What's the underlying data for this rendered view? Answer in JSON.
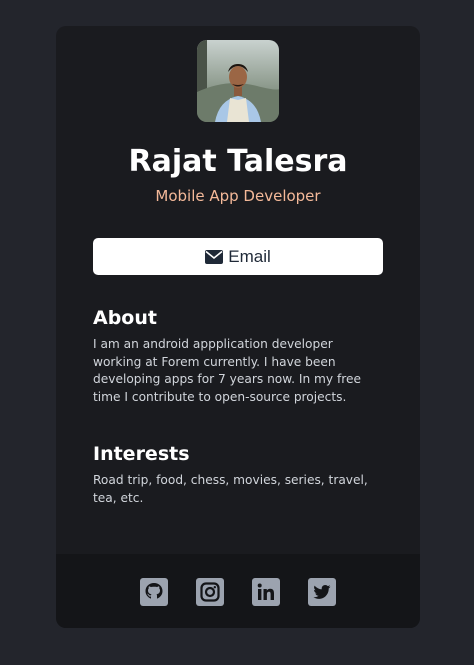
{
  "profile": {
    "name": "Rajat Talesra",
    "role": "Mobile App Developer"
  },
  "actions": {
    "email_label": "Email"
  },
  "about": {
    "title": "About",
    "text": "I am an android appplication developer working at Forem currently. I have been developing apps for 7 years now. In my free time I contribute to open-source projects."
  },
  "interests": {
    "title": "Interests",
    "text": "Road trip, food, chess, movies, series, travel, tea, etc."
  },
  "social": {
    "icons": [
      "github-icon",
      "instagram-icon",
      "linkedin-icon",
      "twitter-icon"
    ]
  },
  "colors": {
    "page_bg": "#23252c",
    "card_bg": "#1a1b1f",
    "footer_bg": "#141518",
    "accent": "#f4b999",
    "icon_gray": "#9ca3af"
  }
}
